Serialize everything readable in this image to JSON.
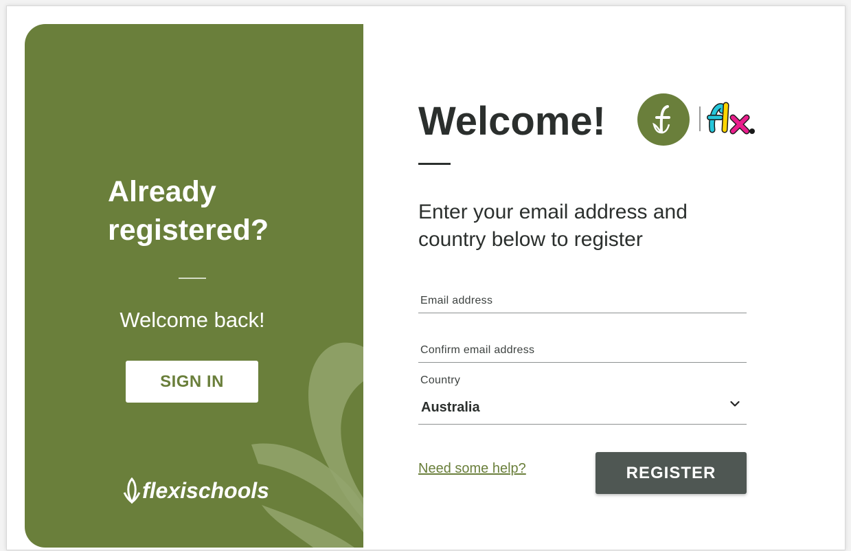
{
  "left_panel": {
    "title": "Already registered?",
    "welcome_back": "Welcome back!",
    "signin_label": "SIGN IN",
    "brand_name": "flexischools"
  },
  "right_panel": {
    "welcome": "Welcome!",
    "subtitle": "Enter your email address and country below to register",
    "email": {
      "label": "Email address",
      "value": ""
    },
    "confirm_email": {
      "label": "Confirm email address",
      "value": ""
    },
    "country": {
      "label": "Country",
      "value": "Australia"
    },
    "help_link": "Need some help?",
    "register_label": "REGISTER"
  },
  "colors": {
    "brand_green": "#6a7f3b",
    "dark_text": "#2b2f2d",
    "register_bg": "#4f5753"
  },
  "icons": [
    "flexischools-leaf-logo-icon",
    "flx-logo-icon",
    "chevron-down-icon"
  ]
}
